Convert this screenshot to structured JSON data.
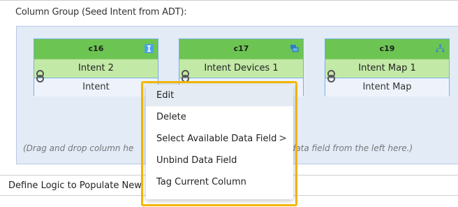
{
  "section_title": "Column Group (Seed Intent from ADT):",
  "cards": [
    {
      "id": "c16",
      "name": "Intent 2",
      "type": "Intent",
      "icon": "intent-icon"
    },
    {
      "id": "c17",
      "name": "Intent Devices 1",
      "type": "",
      "icon": "devices-icon"
    },
    {
      "id": "c19",
      "name": "Intent Map 1",
      "type": "Intent Map",
      "icon": "map-icon"
    }
  ],
  "hint": "(Drag and drop column he                                                     ble data field from the left here.)",
  "logic_label": "Define Logic to Populate New",
  "context_menu": {
    "items": [
      {
        "label": "Edit"
      },
      {
        "label": "Delete"
      },
      {
        "label": "Select Available Data Field",
        "submenu": true
      },
      {
        "label": "Unbind Data Field"
      },
      {
        "label": "Tag Current Column"
      }
    ]
  },
  "colors": {
    "card_header": "#6cc552",
    "card_name": "#c2eaa6",
    "highlight": "#f5b800",
    "group_bg": "#e3ebf7"
  }
}
